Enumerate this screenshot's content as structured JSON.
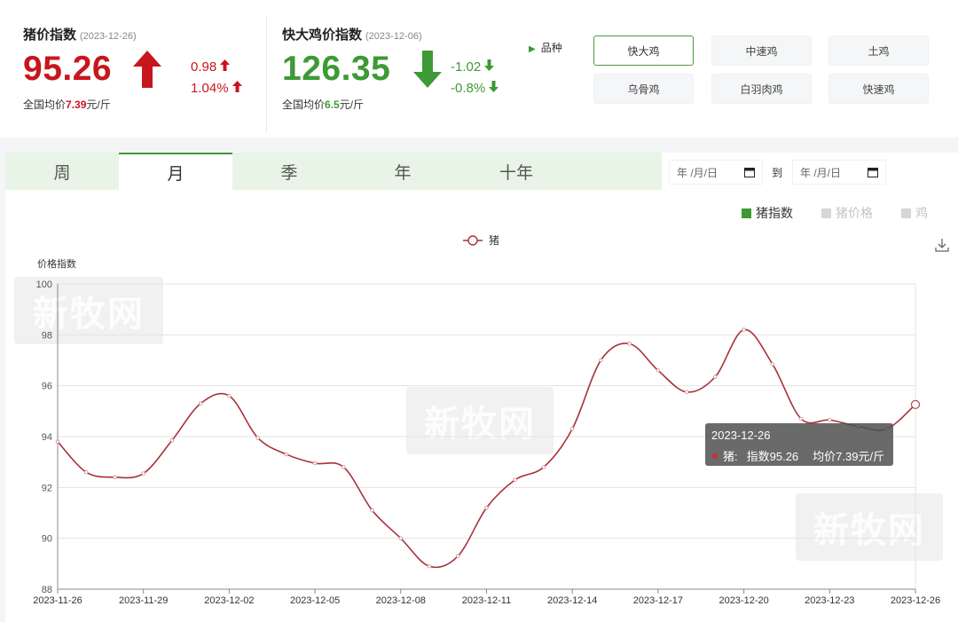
{
  "pig_index": {
    "title": "猪价指数",
    "date": "(2023-12-26)",
    "value": "95.26",
    "delta_abs": "0.98",
    "delta_pct": "1.04%",
    "avg_prefix": "全国均价",
    "avg_value": "7.39",
    "avg_unit": "元/斤"
  },
  "chicken_index": {
    "title": "快大鸡价指数",
    "date": "(2023-12-06)",
    "value": "126.35",
    "delta_abs": "-1.02",
    "delta_pct": "-0.8%",
    "avg_prefix": "全国均价",
    "avg_value": "6.5",
    "avg_unit": "元/斤"
  },
  "variety": {
    "label": "品种",
    "options": [
      "快大鸡",
      "中速鸡",
      "土鸡",
      "乌骨鸡",
      "白羽肉鸡",
      "快速鸡"
    ],
    "selected": "快大鸡"
  },
  "period_tabs": [
    "周",
    "月",
    "季",
    "年",
    "十年"
  ],
  "active_tab": "月",
  "date_range": {
    "start_placeholder": "年 /月/日",
    "to_label": "到",
    "end_placeholder": "年 /月/日"
  },
  "legend_toggles": [
    "猪指数",
    "猪价格",
    "鸡"
  ],
  "colors": {
    "red": "#c8161d",
    "green": "#3d9a35",
    "line": "#a8313a",
    "tab_bg": "#e8f4e6"
  },
  "watermark_text": "新牧网",
  "tooltip": {
    "date": "2023-12-26",
    "series": "猪:",
    "index_text": "指数95.26",
    "avg_text": "均价7.39元/斤"
  },
  "chart_data": {
    "type": "line",
    "series": [
      {
        "name": "猪",
        "x": [
          "2023-11-26",
          "2023-11-27",
          "2023-11-28",
          "2023-11-29",
          "2023-11-30",
          "2023-12-01",
          "2023-12-02",
          "2023-12-03",
          "2023-12-04",
          "2023-12-05",
          "2023-12-06",
          "2023-12-07",
          "2023-12-08",
          "2023-12-09",
          "2023-12-10",
          "2023-12-11",
          "2023-12-12",
          "2023-12-13",
          "2023-12-14",
          "2023-12-15",
          "2023-12-16",
          "2023-12-17",
          "2023-12-18",
          "2023-12-19",
          "2023-12-20",
          "2023-12-21",
          "2023-12-22",
          "2023-12-23",
          "2023-12-24",
          "2023-12-25",
          "2023-12-26"
        ],
        "values": [
          93.8,
          92.6,
          92.4,
          92.55,
          93.85,
          95.3,
          95.6,
          93.95,
          93.3,
          92.95,
          92.8,
          91.1,
          90.0,
          88.9,
          89.3,
          91.2,
          92.3,
          92.8,
          94.3,
          97.0,
          97.65,
          96.6,
          95.75,
          96.35,
          98.2,
          96.85,
          94.7,
          94.65,
          94.4,
          94.3,
          95.26
        ]
      }
    ],
    "ylabel": "价格指数",
    "ylim": [
      88,
      100
    ],
    "yticks": [
      88,
      90,
      92,
      94,
      96,
      98,
      100
    ],
    "xtick_labels": [
      "2023-11-26",
      "2023-11-29",
      "2023-12-02",
      "2023-12-05",
      "2023-12-08",
      "2023-12-11",
      "2023-12-14",
      "2023-12-17",
      "2023-12-20",
      "2023-12-23",
      "2023-12-26"
    ],
    "grid": true,
    "legend": "top-center"
  }
}
